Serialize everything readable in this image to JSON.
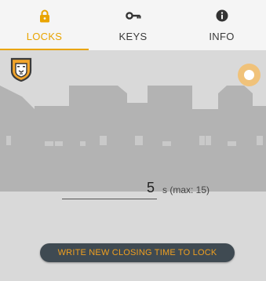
{
  "tabs": [
    {
      "label": "LOCKS",
      "icon": "lock-icon",
      "active": true
    },
    {
      "label": "KEYS",
      "icon": "key-icon",
      "active": false
    },
    {
      "label": "INFO",
      "icon": "info-icon",
      "active": false
    }
  ],
  "colors": {
    "accent": "#e9a400",
    "button_bg": "#3f4a52",
    "button_text": "#f0a020",
    "background": "#d9d9d9",
    "skyline": "#b3b3b3",
    "status_dot": "#f0c27a"
  },
  "closing_time": {
    "value": "5",
    "unit_label": "s (max: 15)"
  },
  "write_button_label": "WRITE NEW CLOSING TIME TO LOCK"
}
